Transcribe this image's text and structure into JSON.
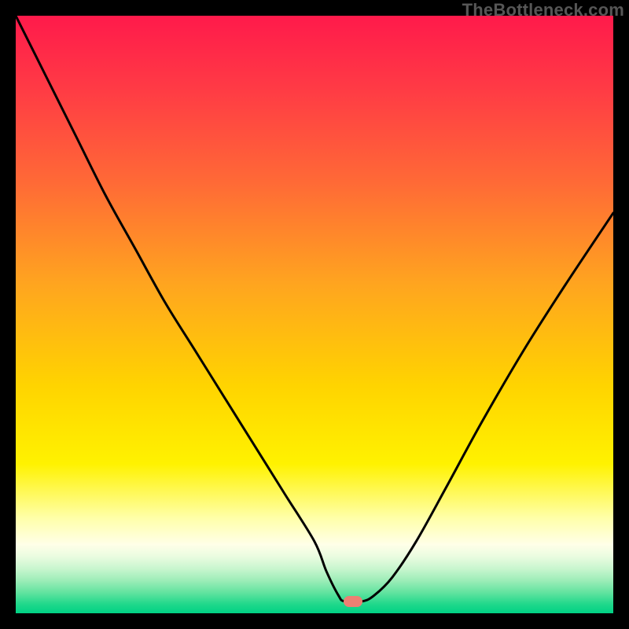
{
  "watermark": "TheBottleneck.com",
  "chart_data": {
    "type": "line",
    "title": "",
    "xlabel": "",
    "ylabel": "",
    "xlim": [
      0,
      100
    ],
    "ylim": [
      0,
      100
    ],
    "series": [
      {
        "name": "bottleneck-curve",
        "x": [
          0,
          5,
          10,
          15,
          20,
          25,
          30,
          35,
          40,
          45,
          50,
          52,
          54,
          55,
          58,
          60,
          63,
          67,
          72,
          78,
          85,
          92,
          100
        ],
        "values": [
          100,
          90,
          80,
          70,
          61,
          52,
          44,
          36,
          28,
          20,
          12,
          7,
          3,
          2,
          2,
          3,
          6,
          12,
          21,
          32,
          44,
          55,
          67
        ]
      }
    ],
    "marker": {
      "x": 56.5,
      "y": 2,
      "color": "#ec8073"
    },
    "gradient_stops": [
      {
        "pos": 0.0,
        "color": "#ff1a4b"
      },
      {
        "pos": 0.12,
        "color": "#ff3a45"
      },
      {
        "pos": 0.28,
        "color": "#ff6a36"
      },
      {
        "pos": 0.45,
        "color": "#ffa51f"
      },
      {
        "pos": 0.62,
        "color": "#ffd400"
      },
      {
        "pos": 0.75,
        "color": "#fff200"
      },
      {
        "pos": 0.84,
        "color": "#ffffa8"
      },
      {
        "pos": 0.885,
        "color": "#ffffe8"
      },
      {
        "pos": 0.905,
        "color": "#eafce0"
      },
      {
        "pos": 0.925,
        "color": "#c9f6cf"
      },
      {
        "pos": 0.945,
        "color": "#9dedb8"
      },
      {
        "pos": 0.965,
        "color": "#63e3a0"
      },
      {
        "pos": 0.985,
        "color": "#1fd88b"
      },
      {
        "pos": 1.0,
        "color": "#00d184"
      }
    ],
    "curve_stroke": "#000000",
    "curve_width": 3
  }
}
